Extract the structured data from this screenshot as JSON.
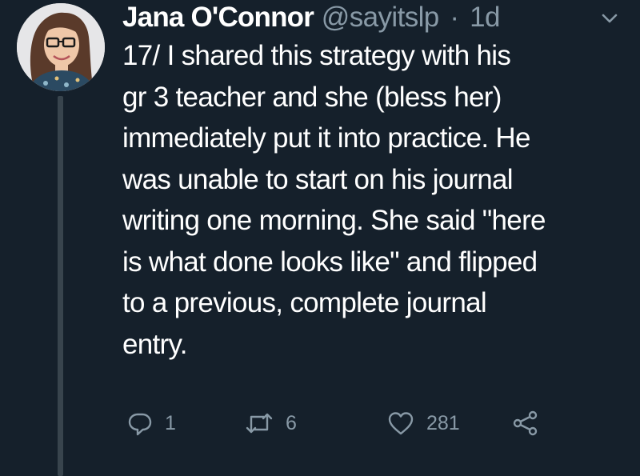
{
  "tweet": {
    "author_name": "Jana O'Connor",
    "handle": "@sayitslp",
    "separator": "·",
    "time": "1d",
    "text_lines": [
      "17/ I shared this strategy with his",
      "gr 3 teacher and she (bless her)",
      "immediately put it into practice. He",
      "was unable to start on his journal",
      "writing one morning. She said \"here",
      "is what done looks like\" and flipped",
      "to a previous, complete journal",
      "entry."
    ],
    "reply_count": "1",
    "retweet_count": "6",
    "like_count": "281"
  },
  "colors": {
    "background": "#15202b",
    "primary_text": "#ffffff",
    "secondary_text": "#8899a6",
    "thread_line": "#38444d"
  },
  "icons": {
    "caret": "chevron-down-icon",
    "reply": "reply-icon",
    "retweet": "retweet-icon",
    "like": "heart-icon",
    "share": "share-icon"
  }
}
